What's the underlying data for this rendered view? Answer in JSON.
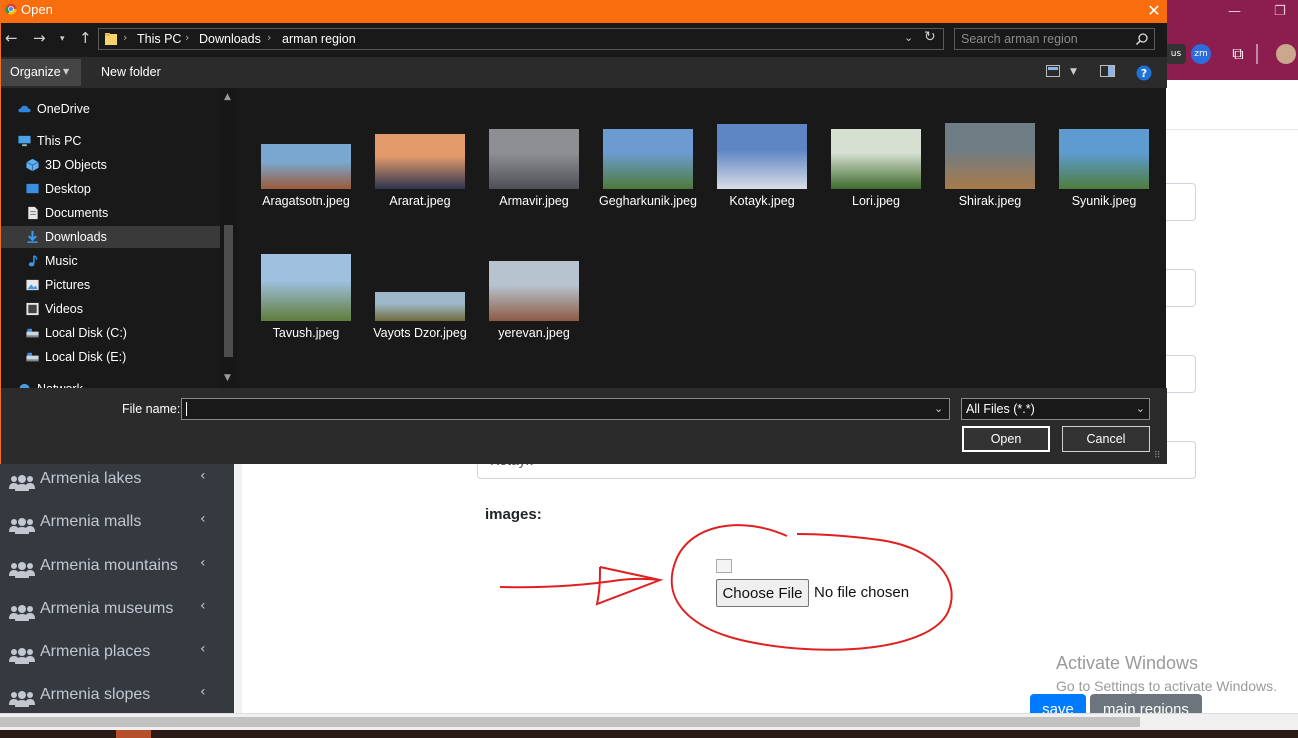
{
  "dialog": {
    "title": "Open",
    "close_glyph": "✕",
    "address": {
      "crumbs": [
        "This PC",
        "Downloads",
        "arman region"
      ]
    },
    "search": {
      "placeholder": "Search arman region"
    },
    "toolbar": {
      "organize": "Organize",
      "new_folder": "New folder"
    },
    "nav_items": [
      {
        "label": "OneDrive",
        "icon": "cloud-icon"
      },
      {
        "label": "This PC",
        "icon": "computer-icon"
      },
      {
        "label": "3D Objects",
        "icon": "cube-icon"
      },
      {
        "label": "Desktop",
        "icon": "desktop-icon"
      },
      {
        "label": "Documents",
        "icon": "document-icon"
      },
      {
        "label": "Downloads",
        "icon": "download-icon",
        "selected": true
      },
      {
        "label": "Music",
        "icon": "music-note-icon"
      },
      {
        "label": "Pictures",
        "icon": "pictures-icon"
      },
      {
        "label": "Videos",
        "icon": "video-icon"
      },
      {
        "label": "Local Disk (C:)",
        "icon": "drive-icon"
      },
      {
        "label": "Local Disk (E:)",
        "icon": "drive-icon"
      },
      {
        "label": "Network",
        "icon": "network-icon"
      }
    ],
    "files": [
      {
        "name": "Aragatsotn.jpeg",
        "colors": [
          "#7aa7cf",
          "#9c5a3a"
        ]
      },
      {
        "name": "Ararat.jpeg",
        "colors": [
          "#e39a6a",
          "#2e3550"
        ]
      },
      {
        "name": "Armavir.jpeg",
        "colors": [
          "#8d8f92",
          "#4e5057"
        ]
      },
      {
        "name": "Gegharkunik.jpeg",
        "colors": [
          "#6b9bd1",
          "#4f7a3a"
        ]
      },
      {
        "name": "Kotayk.jpeg",
        "colors": [
          "#5f86c4",
          "#d9dde6"
        ]
      },
      {
        "name": "Lori.jpeg",
        "colors": [
          "#d5dfd2",
          "#3f6b2c"
        ]
      },
      {
        "name": "Shirak.jpeg",
        "colors": [
          "#6f7d85",
          "#a77a4a"
        ]
      },
      {
        "name": "Syunik.jpeg",
        "colors": [
          "#5d9bd0",
          "#4f7d3c"
        ]
      },
      {
        "name": "Tavush.jpeg",
        "colors": [
          "#9fc0de",
          "#5f7d3b"
        ]
      },
      {
        "name": "Vayots Dzor.jpeg",
        "colors": [
          "#9eb8c9",
          "#6f6a3a"
        ]
      },
      {
        "name": "yerevan.jpeg",
        "colors": [
          "#b7c3cf",
          "#8c5a44"
        ]
      }
    ],
    "file_name": {
      "label": "File name:",
      "value": ""
    },
    "filter": "All Files (*.*)",
    "buttons": {
      "open": "Open",
      "cancel": "Cancel"
    }
  },
  "sidebar": {
    "items": [
      {
        "label": "Armenia lakes"
      },
      {
        "label": "Armenia malls"
      },
      {
        "label": "Armenia mountains"
      },
      {
        "label": "Armenia museums"
      },
      {
        "label": "Armenia places"
      },
      {
        "label": "Armenia slopes"
      }
    ],
    "icon": "users-icon",
    "chevron": "‹"
  },
  "form": {
    "partial_input_text": "Kotayk",
    "images_label": "images:",
    "choose_file": "Choose File",
    "no_file": "No file chosen",
    "save": "save",
    "main_regions": "main regions"
  },
  "watermark": {
    "title": "Activate Windows",
    "subtitle": "Go to Settings to activate Windows."
  },
  "browser": {
    "extensions": [
      "us-icon",
      "zm-icon",
      "puzzle-icon",
      "profile-avatar"
    ],
    "zm_text": "zm",
    "us_text": "us"
  },
  "colors": {
    "dialog_title": "#f86e0f",
    "browser_frame": "#8b1d4f",
    "sidebar": "#343a40",
    "annotation": "#e02020",
    "primary": "#007bff",
    "secondary": "#6c757d"
  }
}
